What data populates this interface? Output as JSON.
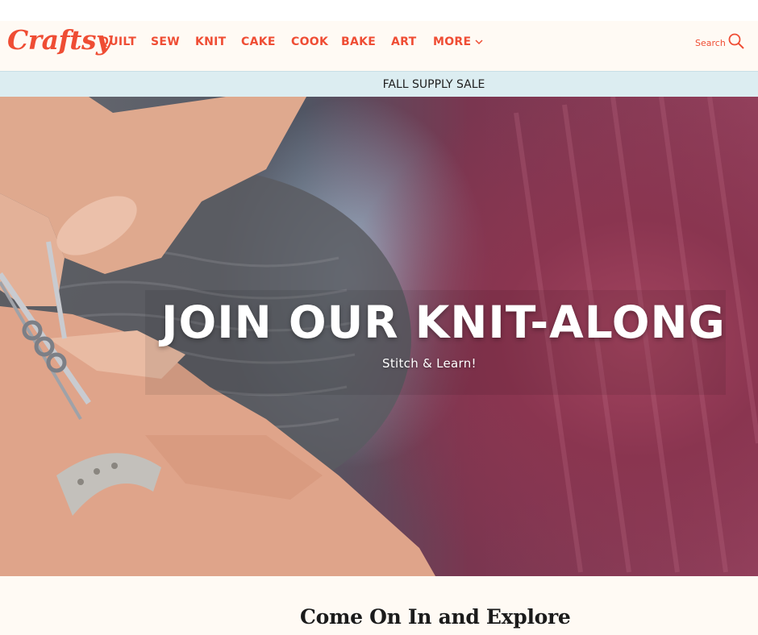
{
  "logo": {
    "text": "Craftsy"
  },
  "nav": {
    "items": [
      {
        "label": "QUILT"
      },
      {
        "label": "SEW"
      },
      {
        "label": "KNIT"
      },
      {
        "label": "CAKE"
      },
      {
        "label": "COOK"
      },
      {
        "label": "BAKE"
      },
      {
        "label": "ART"
      },
      {
        "label": "MORE",
        "icon": "chevron-down-icon"
      }
    ]
  },
  "search": {
    "label": "Search",
    "icon": "search-icon"
  },
  "promo": {
    "text": "FALL SUPPLY SALE"
  },
  "hero": {
    "title": "JOIN OUR KNIT-ALONG",
    "subtitle": "Stitch & Learn!"
  },
  "section": {
    "title": "Come On In and Explore"
  },
  "colors": {
    "brand": "#ef4d34",
    "header_bg": "#fffaf4",
    "promo_bg": "#dcedf1"
  }
}
